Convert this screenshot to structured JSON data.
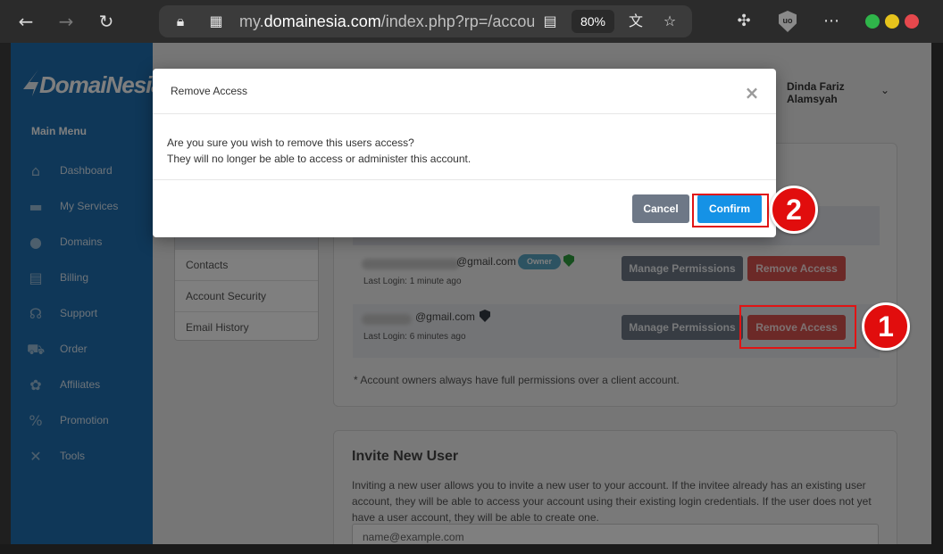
{
  "browser": {
    "url_prefix": "my.",
    "url_host": "domainesia.com",
    "url_path": "/index.php?rp=/account",
    "zoom": "80%",
    "icons": {
      "back": "back-arrow-icon",
      "forward": "forward-arrow-icon",
      "reload": "reload-icon",
      "lock": "lock-icon",
      "site_info": "site-info-icon",
      "reader": "reader-mode-icon",
      "translate": "translate-icon",
      "favorites": "favorites-icon",
      "extensions": "extensions-icon",
      "ublock": "ublock-icon",
      "more": "more-icon"
    },
    "ublock_label": "uo"
  },
  "sidebar": {
    "logo_text": "DomaiNesia",
    "menu_title": "Main Menu",
    "items": [
      {
        "label": "Dashboard",
        "icon": "home-icon",
        "glyph": "⌂"
      },
      {
        "label": "My Services",
        "icon": "server-icon",
        "glyph": "▬"
      },
      {
        "label": "Domains",
        "icon": "globe-icon",
        "glyph": "●"
      },
      {
        "label": "Billing",
        "icon": "invoice-icon",
        "glyph": "▤"
      },
      {
        "label": "Support",
        "icon": "headset-icon",
        "glyph": "☊"
      },
      {
        "label": "Order",
        "icon": "cart-icon",
        "glyph": "⛟"
      },
      {
        "label": "Affiliates",
        "icon": "handshake-icon",
        "glyph": "✿"
      },
      {
        "label": "Promotion",
        "icon": "percent-icon",
        "glyph": "%"
      },
      {
        "label": "Tools",
        "icon": "tools-icon",
        "glyph": "✕"
      }
    ],
    "accent": "#1f6fb0"
  },
  "header": {
    "user_name": "Dinda Fariz Alamsyah"
  },
  "account_nav": {
    "items": [
      "Contacts",
      "Account Security",
      "Email History"
    ]
  },
  "users": {
    "rows": [
      {
        "email_suffix": "@gmail.com",
        "badge": "Owner",
        "last_login": "Last Login: 1 minute ago",
        "manage_label": "Manage Permissions",
        "remove_label": "Remove Access"
      },
      {
        "email_suffix": "@gmail.com",
        "last_login": "Last Login: 6 minutes ago",
        "manage_label": "Manage Permissions",
        "remove_label": "Remove Access"
      }
    ],
    "footnote": "* Account owners always have full permissions over a client account."
  },
  "invite": {
    "title": "Invite New User",
    "description": "Inviting a new user allows you to invite a new user to your account. If the invitee already has an existing user account, they will be able to access your account using their existing login credentials. If the user does not yet have a user account, they will be able to create one.",
    "email_placeholder": "name@example.com"
  },
  "modal": {
    "title": "Remove Access",
    "line1": "Are you sure you wish to remove this users access?",
    "line2": "They will no longer be able to access or administer this account.",
    "cancel_label": "Cancel",
    "confirm_label": "Confirm",
    "close_glyph": "×"
  },
  "annotations": {
    "step1": "1",
    "step2": "2",
    "highlight_color": "#e11414"
  },
  "colors": {
    "confirm_blue": "#1592e6",
    "remove_red": "#d9534f",
    "manage_gray": "#6e7887",
    "owner_badge": "#5aa7c4",
    "shield_green": "#2e9e3e"
  }
}
